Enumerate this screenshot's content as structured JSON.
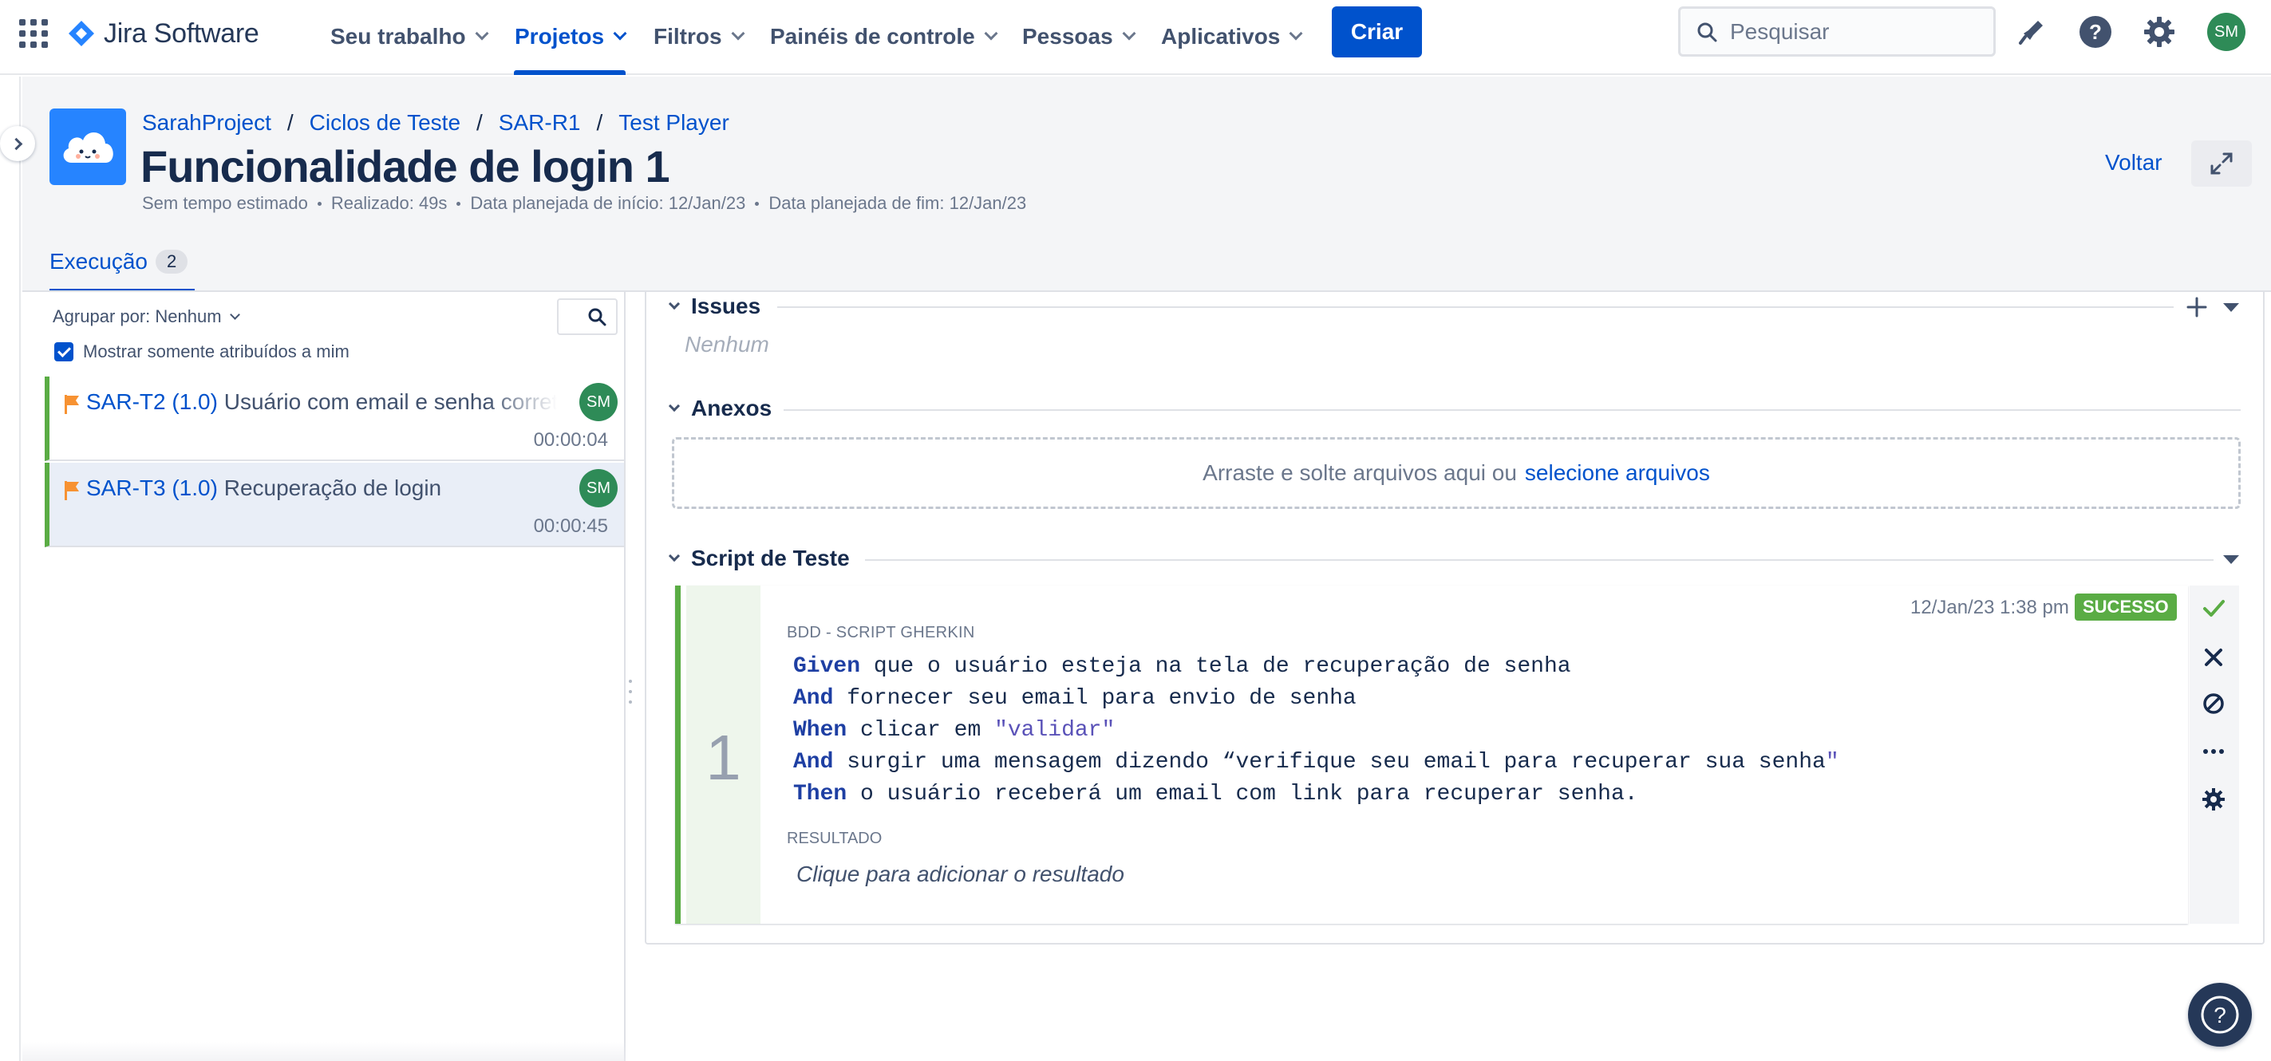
{
  "app": {
    "logo_text": "Jira Software"
  },
  "nav": {
    "items": [
      {
        "label": "Seu trabalho"
      },
      {
        "label": "Projetos"
      },
      {
        "label": "Filtros"
      },
      {
        "label": "Painéis de controle"
      },
      {
        "label": "Pessoas"
      },
      {
        "label": "Aplicativos"
      }
    ],
    "active": "Projetos",
    "create_label": "Criar",
    "search_placeholder": "Pesquisar",
    "avatar_initials": "SM"
  },
  "breadcrumb": {
    "items": [
      "SarahProject",
      "Ciclos de Teste",
      "SAR-R1",
      "Test Player"
    ],
    "separator": "/"
  },
  "page": {
    "title": "Funcionalidade de login 1",
    "meta": [
      "Sem tempo estimado",
      "Realizado: 49s",
      "Data planejada de início: 12/Jan/23",
      "Data planejada de fim: 12/Jan/23"
    ],
    "back_label": "Voltar"
  },
  "tabs": {
    "execution_label": "Execução",
    "execution_count": "2"
  },
  "left_panel": {
    "group_by_label": "Agrupar por: Nenhum",
    "show_mine_label": "Mostrar somente atribuídos a mim",
    "show_mine_checked": true,
    "items": [
      {
        "key": "SAR-T2 (1.0)",
        "name": "Usuário com email e senha correto",
        "time": "00:00:04",
        "avatar": "SM",
        "status_color": "#5aac44"
      },
      {
        "key": "SAR-T3 (1.0)",
        "name": "Recuperação de login",
        "time": "00:00:45",
        "avatar": "SM",
        "status_color": "#5aac44"
      }
    ]
  },
  "sections": {
    "issues_label": "Issues",
    "issues_empty": "Nenhum",
    "attachments_label": "Anexos",
    "drop_text": "Arraste e solte arquivos aqui ou",
    "drop_link": "selecione arquivos",
    "script_label": "Script de Teste"
  },
  "step": {
    "number": "1",
    "date": "12/Jan/23 1:38 pm",
    "status": "SUCESSO",
    "status_color": "#5aac44",
    "script_type_label": "BDD - SCRIPT GHERKIN",
    "lines": [
      {
        "kw": "Given",
        "text": " que o usuário esteja na tela de recuperação de senha",
        "str": ""
      },
      {
        "kw": "And",
        "text": " fornecer seu email para envio de senha",
        "str": ""
      },
      {
        "kw": "When",
        "text": " clicar em ",
        "str": "\"validar\""
      },
      {
        "kw": "And",
        "text": " surgir uma mensagem dizendo “verifique seu email para recuperar sua senha",
        "str": "\""
      },
      {
        "kw": "Then",
        "text": " o usuário receberá um email com link para recuperar senha.",
        "str": ""
      }
    ],
    "result_label": "RESULTADO",
    "result_placeholder": "Clique para adicionar o resultado"
  },
  "colors": {
    "brand": "#0052cc",
    "success": "#5aac44",
    "avatar": "#2e8b57"
  }
}
